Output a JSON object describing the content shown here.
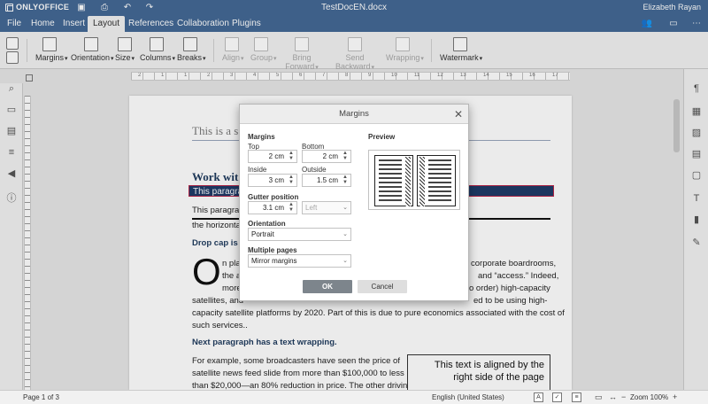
{
  "app": {
    "logo_text": "ONLYOFFICE",
    "document_title": "TestDocEN.docx",
    "user_name": "Elizabeth Rayan"
  },
  "menu": {
    "tabs": [
      {
        "label": "File"
      },
      {
        "label": "Home"
      },
      {
        "label": "Insert"
      },
      {
        "label": "Layout"
      },
      {
        "label": "References"
      },
      {
        "label": "Collaboration"
      },
      {
        "label": "Plugins"
      }
    ],
    "active_tab": "Layout"
  },
  "toolbar": {
    "margins": "Margins",
    "orientation": "Orientation",
    "size": "Size",
    "columns": "Columns",
    "breaks": "Breaks",
    "align": "Align",
    "group": "Group",
    "bring_forward": "Bring Forward",
    "send_backward": "Send Backward",
    "wrapping": "Wrapping",
    "watermark": "Watermark"
  },
  "ruler": {
    "numbers": [
      "2",
      "1",
      "1",
      "2",
      "3",
      "4",
      "5",
      "6",
      "7",
      "8",
      "9",
      "10",
      "11",
      "12",
      "13",
      "14",
      "15",
      "16",
      "17"
    ]
  },
  "document": {
    "heading1": "This is a s",
    "heading2": "Work wit",
    "selected_line": "This paragrap",
    "para1_line1": "This paragrap",
    "para1_line2": "the horizonta",
    "dropcap_heading": "Drop cap is ac",
    "dropcap_letter": "O",
    "dc_line1_left": "n pla",
    "dc_line1_right": "corporate boardrooms,",
    "dc_line2_left": "the a",
    "dc_line2_right": "and “access.” Indeed,",
    "dc_line3_left": "more",
    "dc_line3_right": "o order)  high-capacity",
    "dc_line4_left": "satellites, and",
    "dc_line4_right": "ed to be using high-",
    "dc_line5": "capacity satellite  platforms by 2020. Part of this is due to pure economics associated with  the cost of",
    "dc_line6": "such services..",
    "wrap_heading": "Next paragraph has a text wrapping.",
    "wrap_line1": "For  example,  some  broadcasters  have  seen  the  price  of",
    "wrap_line2": "satellite  news   feed  slide  from  more  than  $100,000  to  less",
    "wrap_line3": "than $20,000—an 80% reduction  in price. The other driving",
    "textbox_text": "This text is aligned by the right side of the page"
  },
  "dialog": {
    "title": "Margins",
    "margins_section": "Margins",
    "top_label": "Top",
    "top_value": "2 cm",
    "bottom_label": "Bottom",
    "bottom_value": "2 cm",
    "inside_label": "Inside",
    "inside_value": "3 cm",
    "outside_label": "Outside",
    "outside_value": "1.5 cm",
    "gutter_label": "Gutter position",
    "gutter_value": "3.1 cm",
    "gutter_side": "Left",
    "orientation_label": "Orientation",
    "orientation_value": "Portrait",
    "multiple_pages_label": "Multiple pages",
    "multiple_pages_value": "Mirror margins",
    "preview_label": "Preview",
    "ok_label": "OK",
    "cancel_label": "Cancel"
  },
  "status": {
    "page_info": "Page 1 of 3",
    "language": "English (United States)",
    "zoom": "Zoom 100%"
  },
  "colors": {
    "header": "#446995",
    "toolbar": "#f1f1f1",
    "ok_button": "#7d858c",
    "selection": "#1f3b68"
  }
}
